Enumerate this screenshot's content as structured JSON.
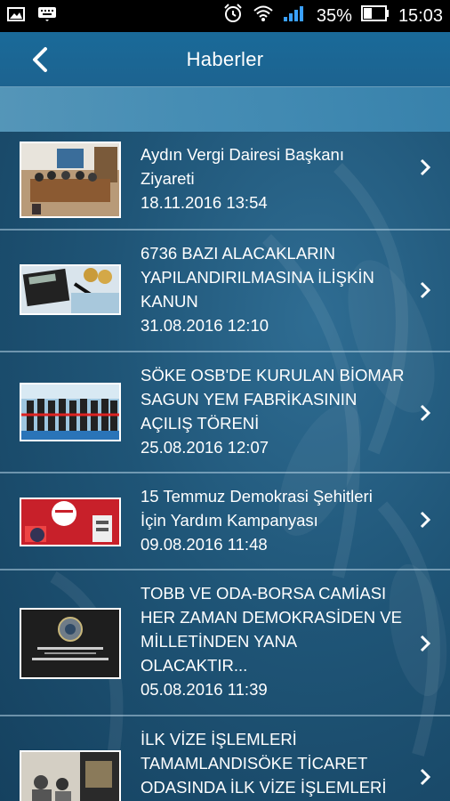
{
  "status_bar": {
    "battery_percent": "35%",
    "time": "15:03",
    "icons": [
      "image-icon",
      "keyboard-icon",
      "alarm-icon",
      "wifi-icon",
      "signal-icon",
      "battery-icon"
    ]
  },
  "header": {
    "title": "Haberler",
    "back_icon": "back-arrow-icon"
  },
  "news": [
    {
      "title": "Aydın Vergi Dairesi Başkanı\nZiyareti",
      "date": "18.11.2016 13:54",
      "thumb": "meeting-room-photo"
    },
    {
      "title": "6736 BAZI ALACAKLARIN\nYAPILANDIRILMASINA İLİŞKİN\nKANUN",
      "date": "31.08.2016 12:10",
      "thumb": "calculator-pen-photo"
    },
    {
      "title": "SÖKE OSB'DE KURULAN BİOMAR\nSAGUN YEM FABRİKASININ\nAÇILIŞ TÖRENİ",
      "date": "25.08.2016 12:07",
      "thumb": "ribbon-ceremony-photo"
    },
    {
      "title": "15 Temmuz Demokrasi Şehitleri\nİçin Yardım Kampanyası",
      "date": "09.08.2016 11:48",
      "thumb": "donation-campaign-photo"
    },
    {
      "title": "TOBB VE ODA-BORSA CAMİASI\nHER ZAMAN DEMOKRASİDEN VE\nMİLLETİNDEN YANA\nOLACAKTIR...",
      "date": "05.08.2016 11:39",
      "thumb": "logo-banner-photo"
    },
    {
      "title": "İLK VİZE İŞLEMLERİ\nTAMAMLANDISÖKE TİCARET\nODASINDA İLK VİZE İŞLEMLERİ",
      "date": "",
      "thumb": "office-photo"
    }
  ],
  "colors": {
    "status_bar": "#000000",
    "app_bar": "#1c6693",
    "background": "#1f5577",
    "text": "#ffffff",
    "divider": "#b4d2e4"
  }
}
